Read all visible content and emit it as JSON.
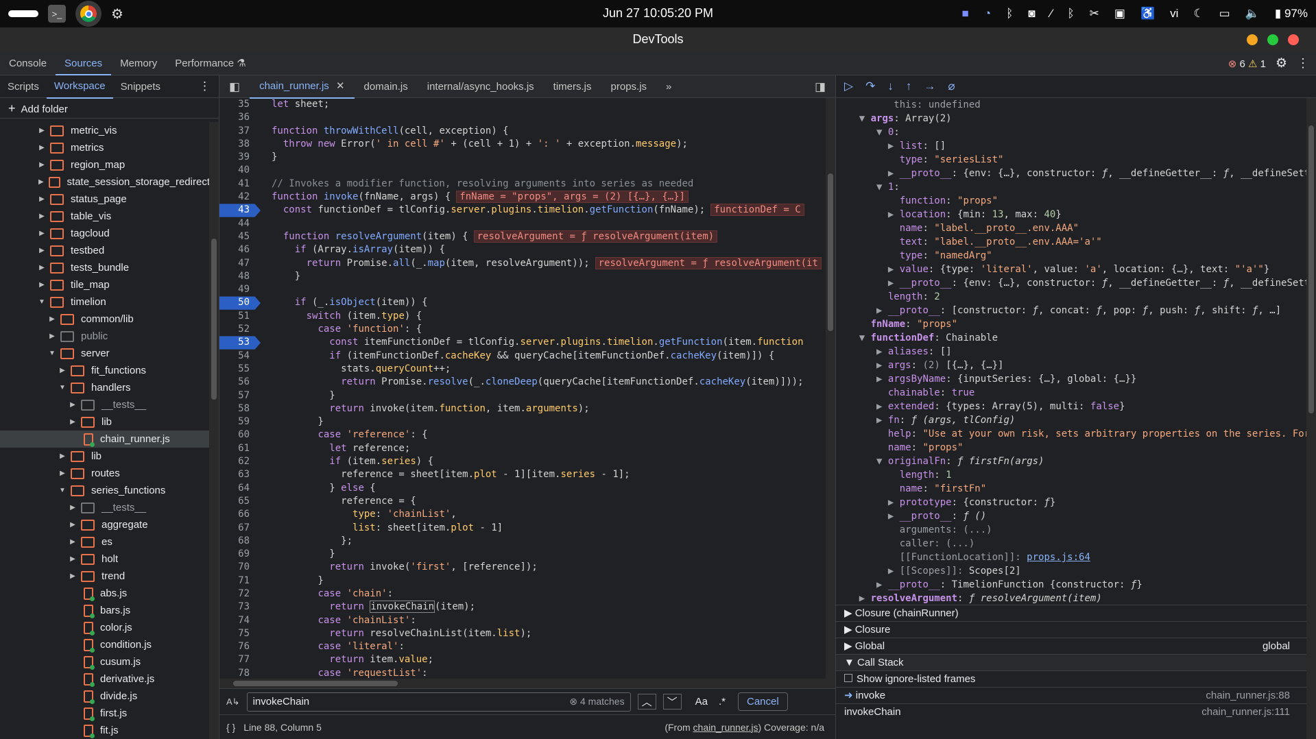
{
  "topbar": {
    "clock": "Jun 27  10:05:20 PM",
    "battery": "97%",
    "lang": "vi"
  },
  "window": {
    "title": "DevTools"
  },
  "main_tabs": [
    "Console",
    "Sources",
    "Memory",
    "Performance"
  ],
  "issues": {
    "errors": "6",
    "warnings": "1"
  },
  "navigator": {
    "tabs": [
      "Scripts",
      "Workspace",
      "Snippets"
    ],
    "add_folder": "Add folder",
    "tree": [
      {
        "label": "metric_vis",
        "d": 3,
        "t": "f",
        "o": false
      },
      {
        "label": "metrics",
        "d": 3,
        "t": "f",
        "o": false
      },
      {
        "label": "region_map",
        "d": 3,
        "t": "f",
        "o": false
      },
      {
        "label": "state_session_storage_redirect",
        "d": 3,
        "t": "f",
        "o": false
      },
      {
        "label": "status_page",
        "d": 3,
        "t": "f",
        "o": false
      },
      {
        "label": "table_vis",
        "d": 3,
        "t": "f",
        "o": false
      },
      {
        "label": "tagcloud",
        "d": 3,
        "t": "f",
        "o": false
      },
      {
        "label": "testbed",
        "d": 3,
        "t": "f",
        "o": false
      },
      {
        "label": "tests_bundle",
        "d": 3,
        "t": "f",
        "o": false
      },
      {
        "label": "tile_map",
        "d": 3,
        "t": "f",
        "o": false
      },
      {
        "label": "timelion",
        "d": 3,
        "t": "f",
        "o": true
      },
      {
        "label": "common/lib",
        "d": 4,
        "t": "f",
        "o": false
      },
      {
        "label": "public",
        "d": 4,
        "t": "f",
        "o": false,
        "dim": true
      },
      {
        "label": "server",
        "d": 4,
        "t": "f",
        "o": true
      },
      {
        "label": "fit_functions",
        "d": 5,
        "t": "f",
        "o": false
      },
      {
        "label": "handlers",
        "d": 5,
        "t": "f",
        "o": true
      },
      {
        "label": "__tests__",
        "d": 6,
        "t": "f",
        "o": false,
        "dim": true
      },
      {
        "label": "lib",
        "d": 6,
        "t": "f",
        "o": false
      },
      {
        "label": "chain_runner.js",
        "d": 6,
        "t": "file",
        "sel": true
      },
      {
        "label": "lib",
        "d": 5,
        "t": "f",
        "o": false
      },
      {
        "label": "routes",
        "d": 5,
        "t": "f",
        "o": false
      },
      {
        "label": "series_functions",
        "d": 5,
        "t": "f",
        "o": true
      },
      {
        "label": "__tests__",
        "d": 6,
        "t": "f",
        "o": false,
        "dim": true
      },
      {
        "label": "aggregate",
        "d": 6,
        "t": "f",
        "o": false
      },
      {
        "label": "es",
        "d": 6,
        "t": "f",
        "o": false
      },
      {
        "label": "holt",
        "d": 6,
        "t": "f",
        "o": false
      },
      {
        "label": "trend",
        "d": 6,
        "t": "f",
        "o": false
      },
      {
        "label": "abs.js",
        "d": 6,
        "t": "file"
      },
      {
        "label": "bars.js",
        "d": 6,
        "t": "file"
      },
      {
        "label": "color.js",
        "d": 6,
        "t": "file"
      },
      {
        "label": "condition.js",
        "d": 6,
        "t": "file"
      },
      {
        "label": "cusum.js",
        "d": 6,
        "t": "file"
      },
      {
        "label": "derivative.js",
        "d": 6,
        "t": "file"
      },
      {
        "label": "divide.js",
        "d": 6,
        "t": "file"
      },
      {
        "label": "first.js",
        "d": 6,
        "t": "file"
      },
      {
        "label": "fit.js",
        "d": 6,
        "t": "file"
      }
    ]
  },
  "editor": {
    "tabs": [
      "chain_runner.js",
      "domain.js",
      "internal/async_hooks.js",
      "timers.js",
      "props.js"
    ],
    "lines": [
      {
        "n": "35",
        "bp": false,
        "h": "<span class='kw'>let</span> sheet;",
        "i": 2
      },
      {
        "n": "36",
        "bp": false,
        "h": "",
        "i": 0
      },
      {
        "n": "37",
        "bp": false,
        "h": "<span class='kw'>function</span> <span class='fn'>throwWithCell</span>(cell, exception) {",
        "i": 1
      },
      {
        "n": "38",
        "bp": false,
        "h": "  <span class='kw'>throw new</span> Error(<span class='str'>' in cell #'</span> + (cell + 1) + <span class='str'>': '</span> + exception.<span class='prop'>message</span>);",
        "i": 1
      },
      {
        "n": "39",
        "bp": false,
        "h": "}",
        "i": 1
      },
      {
        "n": "40",
        "bp": false,
        "h": "",
        "i": 0
      },
      {
        "n": "41",
        "bp": false,
        "h": "<span class='com'>// Invokes a modifier function, resolving arguments into series as needed</span>",
        "i": 1
      },
      {
        "n": "42",
        "bp": false,
        "h": "<span class='kw'>function</span> <span class='fn'>invoke</span>(fnName, args) {<span class='inl'>fnName = \"props\", args = (2) [{…}, {…}]</span>",
        "i": 1
      },
      {
        "n": "43",
        "bp": true,
        "h": "  <span class='kw'>const</span> functionDef = tlConfig.<span class='prop'>server</span>.<span class='prop'>plugins</span>.<span class='prop'>timelion</span>.<span class='fn'>getFunction</span>(fnName);<span class='inl'>functionDef = C</span>",
        "i": 1
      },
      {
        "n": "44",
        "bp": false,
        "h": "",
        "i": 0
      },
      {
        "n": "45",
        "bp": false,
        "h": "  <span class='kw'>function</span> <span class='fn'>resolveArgument</span>(item) {<span class='inl'>resolveArgument = ƒ resolveArgument(item)</span>",
        "i": 1
      },
      {
        "n": "46",
        "bp": false,
        "h": "    <span class='kw'>if</span> (Array.<span class='fn'>isArray</span>(item)) {",
        "i": 1
      },
      {
        "n": "47",
        "bp": false,
        "h": "      <span class='kw'>return</span> Promise.<span class='fn'>all</span>(_.<span class='fn'>map</span>(item, resolveArgument));<span class='inl'>resolveArgument = ƒ resolveArgument(it</span>",
        "i": 1
      },
      {
        "n": "48",
        "bp": false,
        "h": "    }",
        "i": 1
      },
      {
        "n": "49",
        "bp": false,
        "h": "",
        "i": 0
      },
      {
        "n": "50",
        "bp": true,
        "h": "    <span class='kw'>if</span> (_.<span class='fn'>isObject</span>(item)) {",
        "i": 1
      },
      {
        "n": "51",
        "bp": false,
        "h": "      <span class='kw'>switch</span> (item.<span class='prop'>type</span>) {",
        "i": 1
      },
      {
        "n": "52",
        "bp": false,
        "h": "        <span class='kw'>case</span> <span class='str'>'function'</span>: {",
        "i": 1
      },
      {
        "n": "53",
        "bp": true,
        "h": "          <span class='kw'>const</span> itemFunctionDef = tlConfig.<span class='prop'>server</span>.<span class='prop'>plugins</span>.<span class='prop'>timelion</span>.<span class='fn'>getFunction</span>(item.<span class='prop'>function</span>",
        "i": 1
      },
      {
        "n": "54",
        "bp": false,
        "h": "          <span class='kw'>if</span> (itemFunctionDef.<span class='prop'>cacheKey</span> &amp;&amp; queryCache[itemFunctionDef.<span class='fn'>cacheKey</span>(item)]) {",
        "i": 1
      },
      {
        "n": "55",
        "bp": false,
        "h": "            stats.<span class='prop'>queryCount</span>++;",
        "i": 1
      },
      {
        "n": "56",
        "bp": false,
        "h": "            <span class='kw'>return</span> Promise.<span class='fn'>resolve</span>(_.<span class='fn'>cloneDeep</span>(queryCache[itemFunctionDef.<span class='fn'>cacheKey</span>(item)]));",
        "i": 1
      },
      {
        "n": "57",
        "bp": false,
        "h": "          }",
        "i": 1
      },
      {
        "n": "58",
        "bp": false,
        "h": "          <span class='kw'>return</span> invoke(item.<span class='prop'>function</span>, item.<span class='prop'>arguments</span>);",
        "i": 1
      },
      {
        "n": "59",
        "bp": false,
        "h": "        }",
        "i": 1
      },
      {
        "n": "60",
        "bp": false,
        "h": "        <span class='kw'>case</span> <span class='str'>'reference'</span>: {",
        "i": 1
      },
      {
        "n": "61",
        "bp": false,
        "h": "          <span class='kw'>let</span> reference;",
        "i": 1
      },
      {
        "n": "62",
        "bp": false,
        "h": "          <span class='kw'>if</span> (item.<span class='prop'>series</span>) {",
        "i": 1
      },
      {
        "n": "63",
        "bp": false,
        "h": "            reference = sheet[item.<span class='prop'>plot</span> - 1][item.<span class='prop'>series</span> - 1];",
        "i": 1
      },
      {
        "n": "64",
        "bp": false,
        "h": "          } <span class='kw'>else</span> {",
        "i": 1
      },
      {
        "n": "65",
        "bp": false,
        "h": "            reference = {",
        "i": 1
      },
      {
        "n": "66",
        "bp": false,
        "h": "              <span class='prop'>type</span>: <span class='str'>'chainList'</span>,",
        "i": 1
      },
      {
        "n": "67",
        "bp": false,
        "h": "              <span class='prop'>list</span>: sheet[item.<span class='prop'>plot</span> - 1]",
        "i": 1
      },
      {
        "n": "68",
        "bp": false,
        "h": "            };",
        "i": 1
      },
      {
        "n": "69",
        "bp": false,
        "h": "          }",
        "i": 1
      },
      {
        "n": "70",
        "bp": false,
        "h": "          <span class='kw'>return</span> invoke(<span class='str'>'first'</span>, [reference]);",
        "i": 1
      },
      {
        "n": "71",
        "bp": false,
        "h": "        }",
        "i": 1
      },
      {
        "n": "72",
        "bp": false,
        "h": "        <span class='kw'>case</span> <span class='str'>'chain'</span>:",
        "i": 1
      },
      {
        "n": "73",
        "bp": false,
        "h": "          <span class='kw'>return</span> <span style='border:1px solid #888'>invokeChain</span>(item);",
        "i": 1
      },
      {
        "n": "74",
        "bp": false,
        "h": "        <span class='kw'>case</span> <span class='str'>'chainList'</span>:",
        "i": 1
      },
      {
        "n": "75",
        "bp": false,
        "h": "          <span class='kw'>return</span> resolveChainList(item.<span class='prop'>list</span>);",
        "i": 1
      },
      {
        "n": "76",
        "bp": false,
        "h": "        <span class='kw'>case</span> <span class='str'>'literal'</span>:",
        "i": 1
      },
      {
        "n": "77",
        "bp": false,
        "h": "          <span class='kw'>return</span> item.<span class='prop'>value</span>;",
        "i": 1
      },
      {
        "n": "78",
        "bp": false,
        "h": "        <span class='kw'>case</span> <span class='str'>'requestList'</span>:",
        "i": 1
      }
    ],
    "search": {
      "value": "invokeChain",
      "matches": "4 matches",
      "cancel": "Cancel",
      "case": "Aa",
      "regex": ".*"
    },
    "status": {
      "position": "Line 88, Column 5",
      "from_prefix": "(From ",
      "from_file": "chain_runner.js",
      "from_suffix": ")",
      "coverage": "Coverage: n/a"
    }
  },
  "scope": [
    "<span class='d'>        this: undefined</span>",
    "  <span class='d'>▼</span> <span class='kb'>args</span>: Array(2)",
    "     <span class='d'>▼</span> <span class='k'>0</span>:",
    "       <span class='d'>▶</span> <span class='k'>list</span>: []",
    "         <span class='k'>type</span>: <span class='s'>\"seriesList\"</span>",
    "       <span class='d'>▶</span> <span class='k'>__proto__</span>: {env: {…}, constructor: <i>ƒ</i>, __defineGetter__: <i>ƒ</i>, __defineSetter__",
    "     <span class='d'>▼</span> <span class='k'>1</span>:",
    "         <span class='k'>function</span>: <span class='s'>\"props\"</span>",
    "       <span class='d'>▶</span> <span class='k'>location</span>: {min: <span class='n'>13</span>, max: <span class='n'>40</span>}",
    "         <span class='k'>name</span>: <span class='s'>\"label.__proto__.env.AAA\"</span>",
    "         <span class='k'>text</span>: <span class='s'>\"label.__proto__.env.AAA='a'\"</span>",
    "         <span class='k'>type</span>: <span class='s'>\"namedArg\"</span>",
    "       <span class='d'>▶</span> <span class='k'>value</span>: {type: <span class='s'>'literal'</span>, value: <span class='s'>'a'</span>, location: {…}, text: <span class='s'>\"'a'\"</span>}",
    "       <span class='d'>▶</span> <span class='k'>__proto__</span>: {env: {…}, constructor: <i>ƒ</i>, __defineGetter__: <i>ƒ</i>, __defineSetter__",
    "       <span class='k'>length</span>: <span class='n'>2</span>",
    "     <span class='d'>▶</span> <span class='k'>__proto__</span>: [constructor: <i>ƒ</i>, concat: <i>ƒ</i>, pop: <i>ƒ</i>, push: <i>ƒ</i>, shift: <i>ƒ</i>, …]",
    "    <span class='kb'>fnName</span>: <span class='s'>\"props\"</span>",
    "  <span class='d'>▼</span> <span class='kb'>functionDef</span>: Chainable",
    "     <span class='d'>▶</span> <span class='k'>aliases</span>: []",
    "     <span class='d'>▶</span> <span class='k'>args</span>: <span class='d'>(2)</span> [{…}, {…}]",
    "     <span class='d'>▶</span> <span class='k'>argsByName</span>: {inputSeries: {…}, global: {…}}",
    "       <span class='k'>chainable</span>: <span class='b'>true</span>",
    "     <span class='d'>▶</span> <span class='k'>extended</span>: {types: Array(5), multi: <span class='b'>false</span>}",
    "     <span class='d'>▶</span> <span class='k'>fn</span>: <i>ƒ (args, tlConfig)</i>",
    "       <span class='k'>help</span>: <span class='s'>\"Use at your own risk, sets arbitrary properties on the series. For exa</span>",
    "       <span class='k'>name</span>: <span class='s'>\"props\"</span>",
    "     <span class='d'>▼</span> <span class='k'>originalFn</span>: <i>ƒ firstFn(args)</i>",
    "         <span class='k'>length</span>: <span class='n'>1</span>",
    "         <span class='k'>name</span>: <span class='s'>\"firstFn\"</span>",
    "       <span class='d'>▶</span> <span class='k'>prototype</span>: {constructor: <i>ƒ</i>}",
    "       <span class='d'>▶</span> <span class='k'>__proto__</span>: <i>ƒ ()</i>",
    "         <span class='d'>arguments: (...)</span>",
    "         <span class='d'>caller: (...)</span>",
    "         <span class='d'>[[FunctionLocation]]:</span> <span class='lnk'>props.js:64</span>",
    "       <span class='d'>▶ [[Scopes]]:</span> Scopes[2]",
    "     <span class='d'>▶</span> <span class='k'>__proto__</span>: TimelionFunction {constructor: <i>ƒ</i>}",
    "  <span class='d'>▶</span> <span class='kb'>resolveArgument</span>: <i>ƒ resolveArgument(item)</i>"
  ],
  "sections": {
    "closure1": "Closure (chainRunner)",
    "closure2": "Closure",
    "global": "Global",
    "global_val": "global",
    "callstack": "Call Stack",
    "ignore": "Show ignore-listed frames"
  },
  "frames": [
    {
      "fn": "invoke",
      "loc": "chain_runner.js:88",
      "cur": true
    },
    {
      "fn": "invokeChain",
      "loc": "chain_runner.js:111",
      "cur": false
    }
  ]
}
